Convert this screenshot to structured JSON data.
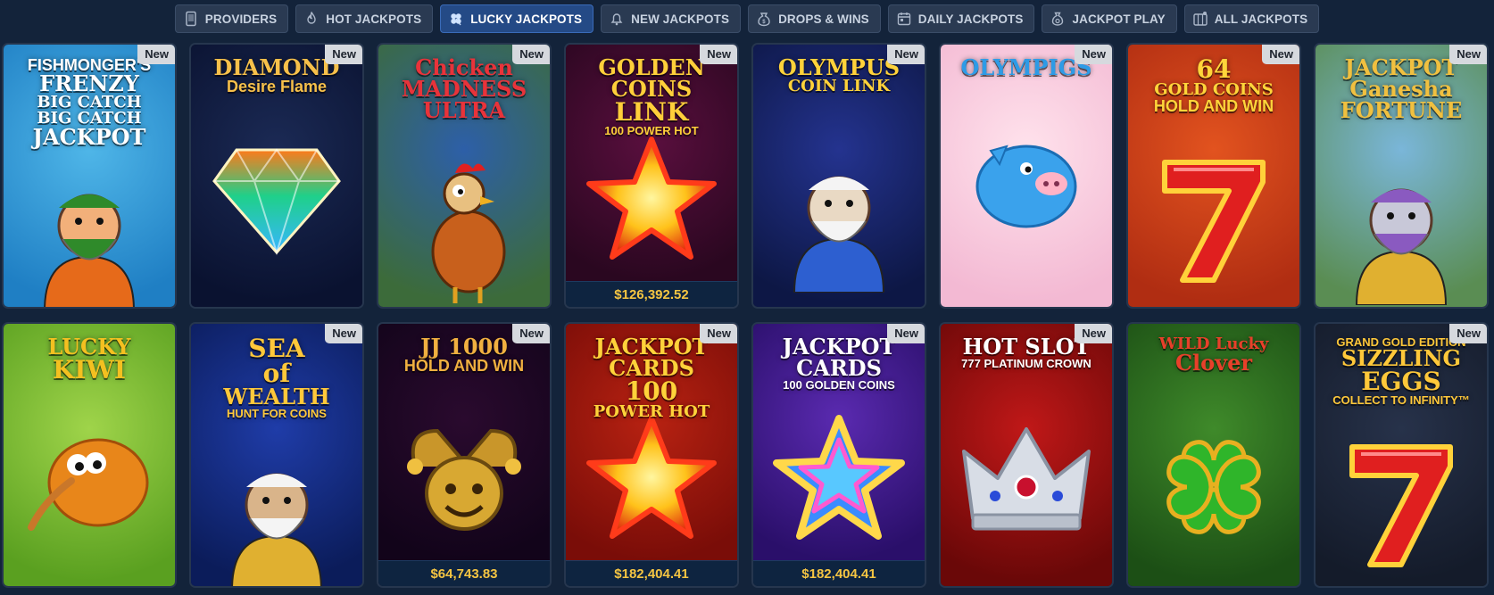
{
  "tabs": [
    {
      "label": "PROVIDERS",
      "icon": "phone-icon",
      "active": false
    },
    {
      "label": "HOT JACKPOTS",
      "icon": "flame-icon",
      "active": false
    },
    {
      "label": "LUCKY JACKPOTS",
      "icon": "clover-icon",
      "active": true
    },
    {
      "label": "NEW JACKPOTS",
      "icon": "bell-icon",
      "active": false
    },
    {
      "label": "DROPS & WINS",
      "icon": "coin-bag-icon",
      "active": false
    },
    {
      "label": "DAILY JACKPOTS",
      "icon": "calendar-icon",
      "active": false
    },
    {
      "label": "JACKPOT PLAY",
      "icon": "money-bag-icon",
      "active": false
    },
    {
      "label": "ALL JACKPOTS",
      "icon": "jackpot-grid-icon",
      "active": false
    }
  ],
  "games": [
    {
      "title": [
        "FISHMONGER'S",
        "FRENZY",
        "BIG CATCH",
        "BIG CATCH",
        "JACKPOT"
      ],
      "badge": "New",
      "jackpot": null,
      "bg": [
        "#4fb6e8",
        "#1f7fc4"
      ],
      "title_color": "#ffffff",
      "glyph": "fisherman"
    },
    {
      "title": [
        "DIAMOND",
        "Desire Flame"
      ],
      "badge": "New",
      "jackpot": null,
      "bg": [
        "#1b2a55",
        "#0a1230"
      ],
      "title_color": "#f7c04a",
      "glyph": "diamond"
    },
    {
      "title": [
        "Chicken",
        "MADNESS",
        "ULTRA"
      ],
      "badge": "New",
      "jackpot": null,
      "bg": [
        "#2d5fa8",
        "#3c6b3a"
      ],
      "title_color": "#e8333a",
      "glyph": "rooster"
    },
    {
      "title": [
        "GOLDEN",
        "COINS",
        "LINK",
        "100 POWER HOT"
      ],
      "badge": "New",
      "jackpot": "$126,392.52",
      "bg": [
        "#5a0f3e",
        "#2a0720"
      ],
      "title_color": "#ffcf3a",
      "glyph": "star"
    },
    {
      "title": [
        "OLYMPUS",
        "COIN LINK"
      ],
      "badge": "New",
      "jackpot": null,
      "bg": [
        "#24338f",
        "#0d1745"
      ],
      "title_color": "#ffd23a",
      "glyph": "zeus"
    },
    {
      "title": [
        "OLYMPIGS"
      ],
      "badge": "New",
      "jackpot": null,
      "bg": [
        "#ffe2ec",
        "#f3b9d3"
      ],
      "title_color": "#2e9be6",
      "glyph": "pig"
    },
    {
      "title": [
        "64",
        "GOLD COINS",
        "HOLD AND WIN"
      ],
      "badge": "New",
      "jackpot": null,
      "bg": [
        "#e2531f",
        "#b02d12"
      ],
      "title_color": "#ffd53a",
      "glyph": "seven"
    },
    {
      "title": [
        "JACKPOT",
        "Ganesha",
        "FORTUNE"
      ],
      "badge": "New",
      "jackpot": null,
      "bg": [
        "#7ab6d9",
        "#5a8d53"
      ],
      "title_color": "#f0c040",
      "glyph": "elephant"
    },
    {
      "title": [
        "LUCKY",
        "KIWI"
      ],
      "badge": null,
      "jackpot": null,
      "bg": [
        "#9fd44a",
        "#5aa020"
      ],
      "title_color": "#f4c020",
      "glyph": "kiwi"
    },
    {
      "title": [
        "SEA",
        "of",
        "WEALTH",
        "HUNT FOR COINS"
      ],
      "badge": "New",
      "jackpot": null,
      "bg": [
        "#1f3ca8",
        "#0b1c5a"
      ],
      "title_color": "#ffc83a",
      "glyph": "poseidon"
    },
    {
      "title": [
        "JJ 1000",
        "HOLD AND WIN"
      ],
      "badge": "New",
      "jackpot": "$64,743.83",
      "bg": [
        "#2a0a2e",
        "#12041a"
      ],
      "title_color": "#f0b040",
      "glyph": "jester"
    },
    {
      "title": [
        "JACKPOT",
        "CARDS",
        "100",
        "POWER HOT"
      ],
      "badge": "New",
      "jackpot": "$182,404.41",
      "bg": [
        "#b82212",
        "#7a0d08"
      ],
      "title_color": "#ffd23a",
      "glyph": "star"
    },
    {
      "title": [
        "JACKPOT",
        "CARDS",
        "100 GOLDEN COINS"
      ],
      "badge": "New",
      "jackpot": "$182,404.41",
      "bg": [
        "#5a2ab0",
        "#2a0f6a"
      ],
      "title_color": "#ffffff",
      "glyph": "neonstar"
    },
    {
      "title": [
        "HOT SLOT",
        "777 PLATINUM CROWN"
      ],
      "badge": "New",
      "jackpot": null,
      "bg": [
        "#c01818",
        "#6a0808"
      ],
      "title_color": "#ffffff",
      "glyph": "crown"
    },
    {
      "title": [
        "WILD Lucky",
        "Clover"
      ],
      "badge": null,
      "jackpot": null,
      "bg": [
        "#3f8a2a",
        "#1c4f15"
      ],
      "title_color": "#e8402a",
      "glyph": "clover"
    },
    {
      "title": [
        "GRAND GOLD EDITION",
        "SIZZLING",
        "EGGS",
        "COLLECT TO INFINITY™"
      ],
      "badge": "New",
      "jackpot": null,
      "bg": [
        "#27324a",
        "#141b2a"
      ],
      "title_color": "#ffc83a",
      "glyph": "seven"
    }
  ]
}
